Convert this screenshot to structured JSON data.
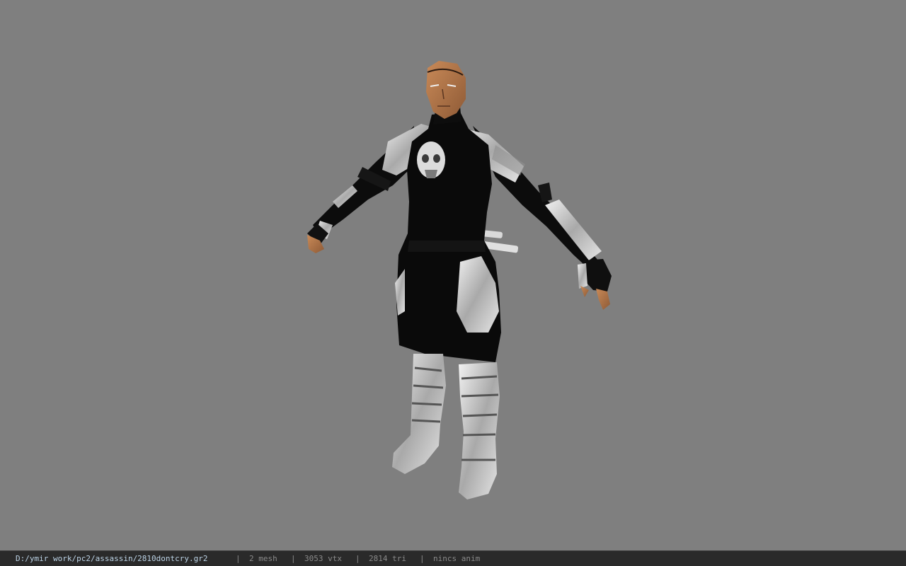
{
  "viewport": {
    "background_color": "#7f7f7f",
    "model": "assassin-character-model"
  },
  "statusbar": {
    "file_path": "D:/ymir work/pc2/assassin/2810dontcry.gr2",
    "separator": "|",
    "mesh": "2 mesh",
    "vertices": "3053 vtx",
    "triangles": "2814 tri",
    "animation": "nincs anim"
  }
}
